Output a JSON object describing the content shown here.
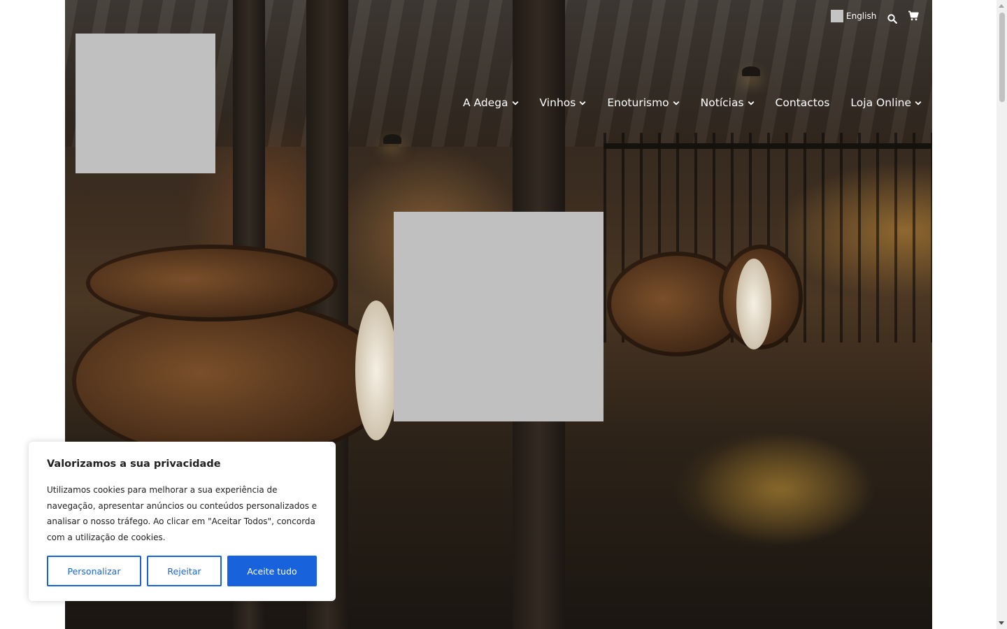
{
  "header": {
    "language": {
      "label": "English",
      "flag_icon": "flag-icon"
    },
    "search_icon": "search-icon",
    "cart_icon": "cart-icon"
  },
  "nav": {
    "items": [
      {
        "label": "A Adega",
        "has_dropdown": true
      },
      {
        "label": "Vinhos",
        "has_dropdown": true
      },
      {
        "label": "Enoturismo",
        "has_dropdown": true
      },
      {
        "label": "Notícias",
        "has_dropdown": true
      },
      {
        "label": "Contactos",
        "has_dropdown": false
      },
      {
        "label": "Loja Online",
        "has_dropdown": true
      }
    ]
  },
  "cookie_banner": {
    "title": "Valorizamos a sua privacidade",
    "text": "Utilizamos cookies para melhorar a sua experiência de navegação, apresentar anúncios ou conteúdos personalizados e analisar o nosso tráfego. Ao clicar em \"Aceitar Todos\", concorda com a utilização de cookies.",
    "buttons": {
      "customize": "Personalizar",
      "reject": "Rejeitar",
      "accept_all": "Aceite tudo"
    }
  },
  "colors": {
    "accent": "#1863dc",
    "placeholder": "#c0c0c0",
    "nav_text": "#ffffff"
  }
}
